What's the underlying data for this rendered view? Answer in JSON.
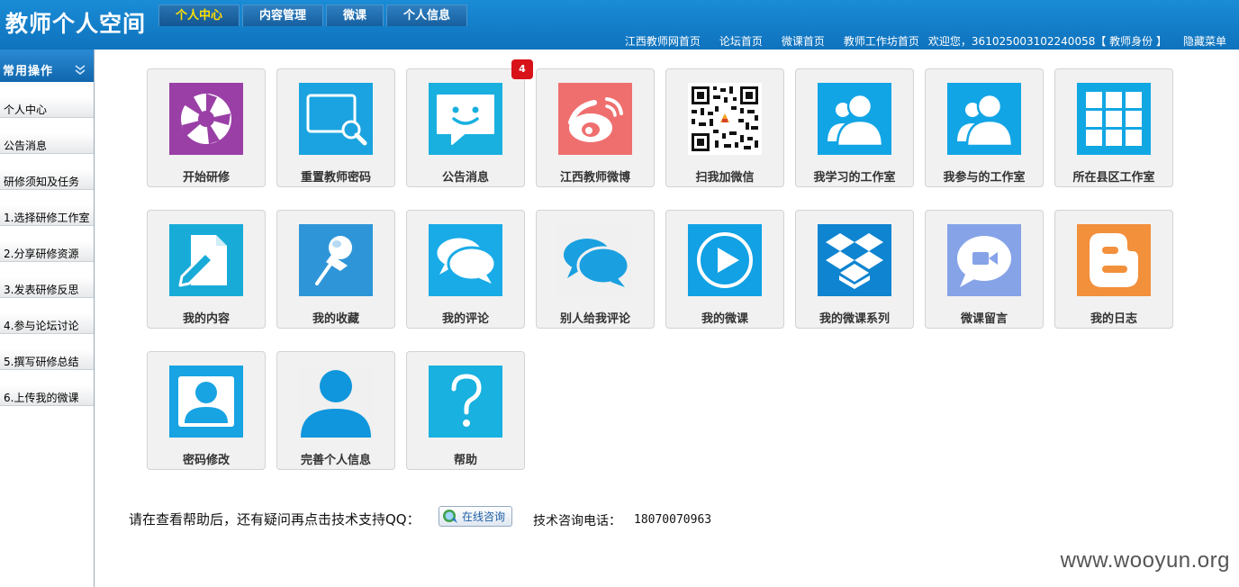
{
  "header": {
    "title": "教师个人空间",
    "tabs": [
      {
        "label": "个人中心",
        "active": true
      },
      {
        "label": "内容管理",
        "active": false
      },
      {
        "label": "微课",
        "active": false
      },
      {
        "label": "个人信息",
        "active": false
      }
    ],
    "links": [
      "江西教师网首页",
      "论坛首页",
      "微课首页",
      "教师工作坊首页"
    ],
    "welcome": "欢迎您，361025003102240058【 教师身份 】",
    "hide_menu": "隐藏菜单"
  },
  "sidebar": {
    "title": "常用操作",
    "items": [
      "个人中心",
      "公告消息",
      "研修须知及任务",
      "1.选择研修工作室",
      "2.分享研修资源",
      "3.发表研修反思",
      "4.参与论坛讨论",
      "5.撰写研修总结",
      "6.上传我的微课"
    ]
  },
  "tiles": [
    {
      "label": "开始研修",
      "icon": "aperture-icon",
      "color": "#9a3fa6"
    },
    {
      "label": "重置教师密码",
      "icon": "magnifier-screen-icon",
      "color": "#1aa3e0"
    },
    {
      "label": "公告消息",
      "icon": "chat-smile-icon",
      "color": "#19b0df"
    },
    {
      "label": "江西教师微博",
      "icon": "weibo-icon",
      "color": "#ef6f6f"
    },
    {
      "label": "扫我加微信",
      "icon": "qr-code-icon",
      "color": "#ffffff"
    },
    {
      "label": "我学习的工作室",
      "icon": "users-icon",
      "color": "#12a5e6"
    },
    {
      "label": "我参与的工作室",
      "icon": "users-icon",
      "color": "#12a5e6"
    },
    {
      "label": "所在县区工作室",
      "icon": "grid-icon",
      "color": "#11a7e3"
    },
    {
      "label": "我的内容",
      "icon": "edit-document-icon",
      "color": "#19abd8"
    },
    {
      "label": "我的收藏",
      "icon": "pushpin-icon",
      "color": "#2e96d8"
    },
    {
      "label": "我的评论",
      "icon": "chat-bubbles-icon",
      "color": "#19abe7"
    },
    {
      "label": "别人给我评论",
      "icon": "chat-bubbles-blue-icon",
      "color": "#f0f0f0"
    },
    {
      "label": "我的微课",
      "icon": "play-icon",
      "color": "#11a1e4"
    },
    {
      "label": "我的微课系列",
      "icon": "dropbox-icon",
      "color": "#0f84d0"
    },
    {
      "label": "微课留言",
      "icon": "video-chat-icon",
      "color": "#86a3e8"
    },
    {
      "label": "我的日志",
      "icon": "blogger-icon",
      "color": "#f2903c"
    },
    {
      "label": "密码修改",
      "icon": "user-card-icon",
      "color": "#18a3e3"
    },
    {
      "label": "完善个人信息",
      "icon": "user-icon",
      "color": "#f0f0f0"
    },
    {
      "label": "帮助",
      "icon": "question-icon",
      "color": "#18b1e0"
    }
  ],
  "notice_badge": "4",
  "footer": {
    "help_text": "请在查看帮助后，还有疑问再点击技术支持QQ：",
    "qq_button": "在线咨询",
    "phone_label": "技术咨询电话：",
    "phone": "18070070963"
  },
  "watermark": "www.wooyun.org"
}
